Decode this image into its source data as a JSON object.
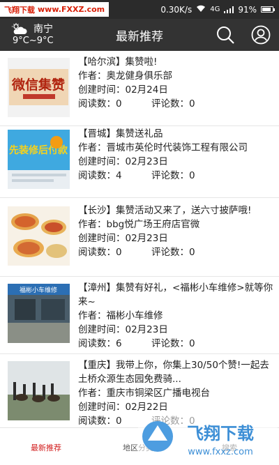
{
  "watermark_top": {
    "brand": "飞翔下载",
    "url": "www.FXXZ.com"
  },
  "statusbar": {
    "speed": "0.30K/s",
    "network": "4G",
    "battery": "91%"
  },
  "header": {
    "city": "南宁",
    "temp": "9°C~9°C",
    "title": "最新推荐"
  },
  "labels": {
    "author": "作者：",
    "created": "创建时间：",
    "reads": "阅读数：",
    "comments": "评论数："
  },
  "items": [
    {
      "title": "【哈尔滨】集赞啦!",
      "author": "奥龙健身俱乐部",
      "date": "02月24日",
      "reads": "0",
      "comments": "0",
      "thumb": "微信集赞"
    },
    {
      "title": "【晋城】集赞送礼品",
      "author": "晋城市英伦时代装饰工程有限公司",
      "date": "02月23日",
      "reads": "4",
      "comments": "0",
      "thumb": "先装修后付款"
    },
    {
      "title": "【长沙】集赞活动又来了，送六寸披萨哦!",
      "author": "bbg悦广场王府店官微",
      "date": "02月23日",
      "reads": "0",
      "comments": "0",
      "thumb": "pizza"
    },
    {
      "title": "【漳州】集赞有好礼，<福彬小车维修>就等你来~",
      "author": "福彬小车维修",
      "date": "02月23日",
      "reads": "6",
      "comments": "0",
      "thumb": "福彬小车维修"
    },
    {
      "title": "【重庆】我带上你，你集上30/50个赞!一起去土桥众源生态园免费骑...",
      "author": "重庆市铜梁区广播电视台",
      "date": "02月22日",
      "reads": "0",
      "comments": "0",
      "thumb": "horses"
    }
  ],
  "tabs": [
    "最新推荐",
    "地区分类",
    "搜索"
  ],
  "watermark_bottom": {
    "brand": "飞翔下载",
    "url": "www.fxxz.com"
  }
}
